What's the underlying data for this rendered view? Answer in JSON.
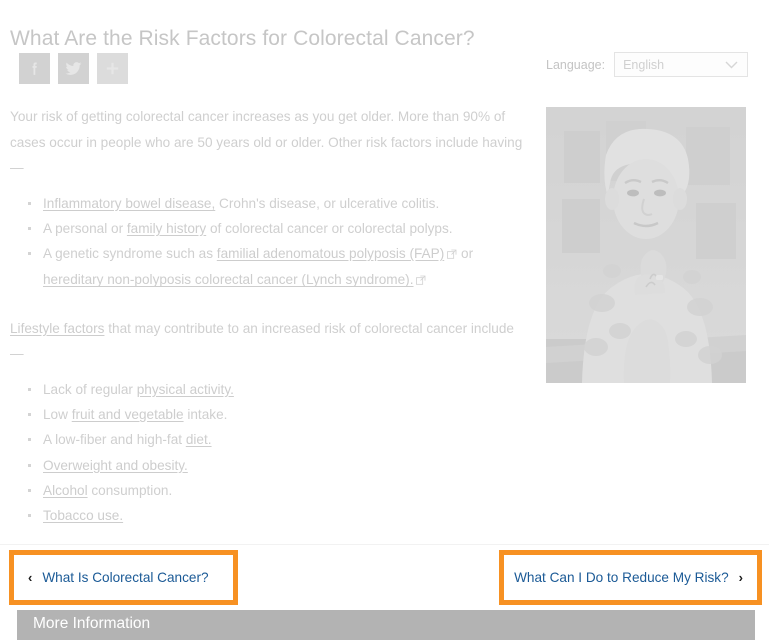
{
  "page": {
    "title": "What Are the Risk Factors for Colorectal Cancer?"
  },
  "share": {
    "facebook_label": "f",
    "twitter_label": "twitter-bird",
    "more_label": "+",
    "items": [
      {
        "name": "facebook-share-button",
        "icon": "facebook-icon"
      },
      {
        "name": "twitter-share-button",
        "icon": "twitter-icon"
      },
      {
        "name": "more-share-button",
        "icon": "plus-icon"
      }
    ]
  },
  "language": {
    "label": "Language:",
    "selected": "English",
    "options": [
      "English"
    ]
  },
  "intro": {
    "paragraph": "Your risk of getting colorectal cancer increases as you get older. More than 90% of cases occur in people who are 50 years old or older. Other risk factors include having—"
  },
  "risk_list": {
    "item1_link": "Inflammatory bowel disease,",
    "item1_rest": " Crohn's disease, or ulcerative colitis.",
    "item2_pre": "A personal or ",
    "item2_link": "family history",
    "item2_rest": " of colorectal cancer or colorectal polyps.",
    "item3_pre": "A genetic syndrome such as ",
    "item3_link": "familial adenomatous polyposis (FAP)",
    "item3_mid": "or",
    "item3_link2": "hereditary non-polyposis colorectal cancer (Lynch syndrome).",
    "external_icon": "external-link-icon"
  },
  "lifestyle": {
    "link": "Lifestyle factors",
    "rest": " that may contribute to an increased risk of colorectal cancer include",
    "dash": "—"
  },
  "lifestyle_list": {
    "item1_pre": "Lack of regular ",
    "item1_link": "physical activity.",
    "item2_pre": "Low ",
    "item2_link": "fruit and vegetable",
    "item2_rest": " intake.",
    "item3_pre": "A low-fiber and high-fat ",
    "item3_link": "diet.",
    "item4_link": "Overweight and obesity.",
    "item5_link": "Alcohol",
    "item5_rest": " consumption.",
    "item6_link": "Tobacco use."
  },
  "photo": {
    "alt": "older-woman-portrait"
  },
  "pager": {
    "prev_arrow": "‹",
    "prev_label": "What Is Colorectal Cancer?",
    "next_label": "What Can I Do to Reduce My Risk?",
    "next_arrow": "›"
  },
  "more_information": {
    "title": "More Information"
  },
  "colors": {
    "highlight_orange": "#F79122",
    "link_blue": "#1B5A96",
    "more_bar_gray": "#b3b3b3",
    "text_gray": "#cfcfcf"
  }
}
